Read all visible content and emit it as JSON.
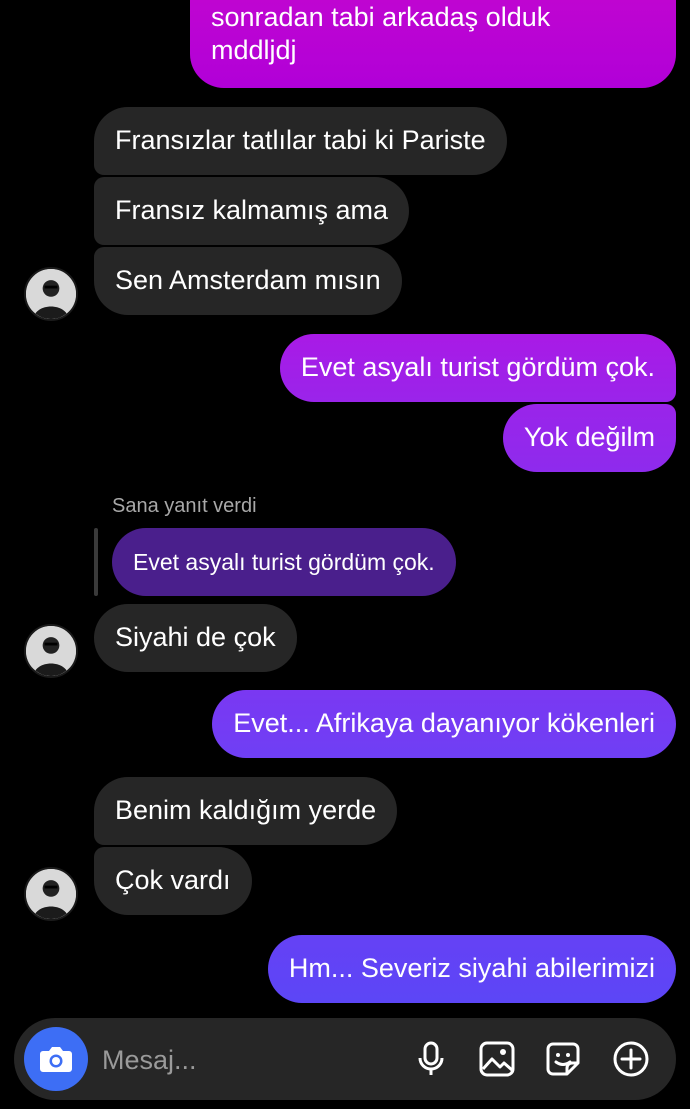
{
  "theme": {
    "incoming_bubble": "#262626",
    "outgoing_gradient_top": "#b300d4",
    "outgoing_gradient_bottom": "#6a3cf5",
    "reply_quote": "#4a1f8c",
    "camera_button": "#3d6ef5"
  },
  "messages": [
    {
      "from": "me",
      "text": "sonradan tabi arkadaş olduk\nmddljdj"
    },
    {
      "from": "them",
      "text": "Fransızlar tatlılar tabi ki Pariste"
    },
    {
      "from": "them",
      "text": "Fransız kalmamış ama"
    },
    {
      "from": "them",
      "text": "Sen Amsterdam mısın"
    },
    {
      "from": "me",
      "text": "Evet asyalı turist gördüm çok."
    },
    {
      "from": "me",
      "text": "Yok değilm"
    },
    {
      "from": "them",
      "text": "Siyahi de çok",
      "reply_label": "Sana yanıt verdi",
      "reply_quote": "Evet asyalı turist gördüm çok."
    },
    {
      "from": "me",
      "text": "Evet... Afrikaya dayanıyor kökenleri"
    },
    {
      "from": "them",
      "text": "Benim kaldığım yerde"
    },
    {
      "from": "them",
      "text": "Çok vardı"
    },
    {
      "from": "me",
      "text": "Hm... Severiz siyahi abilerimizi"
    }
  ],
  "composer": {
    "placeholder": "Mesaj...",
    "value": "",
    "icons": [
      "camera-icon",
      "microphone-icon",
      "gallery-icon",
      "sticker-icon",
      "add-icon"
    ]
  }
}
